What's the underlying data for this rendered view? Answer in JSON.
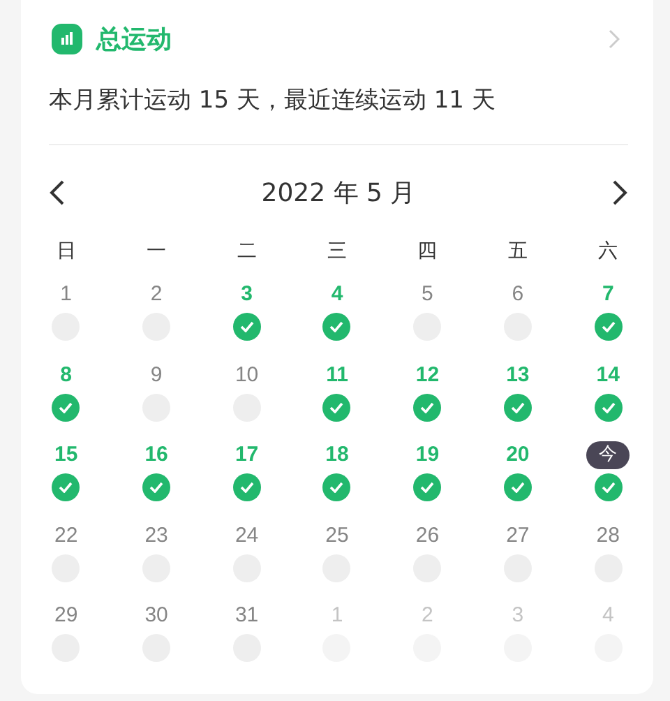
{
  "header": {
    "title": "总运动"
  },
  "summary": "本月累计运动 15 天，最近连续运动 11 天",
  "calendar": {
    "month": "2022 年 5 月",
    "weekdays": [
      "日",
      "一",
      "二",
      "三",
      "四",
      "五",
      "六"
    ],
    "weeks": [
      {
        "days": [
          {
            "label": "1",
            "checked": false,
            "in_month": true,
            "today": false
          },
          {
            "label": "2",
            "checked": false,
            "in_month": true,
            "today": false
          },
          {
            "label": "3",
            "checked": true,
            "in_month": true,
            "today": false
          },
          {
            "label": "4",
            "checked": true,
            "in_month": true,
            "today": false
          },
          {
            "label": "5",
            "checked": false,
            "in_month": true,
            "today": false
          },
          {
            "label": "6",
            "checked": false,
            "in_month": true,
            "today": false
          },
          {
            "label": "7",
            "checked": true,
            "in_month": true,
            "today": false
          }
        ]
      },
      {
        "days": [
          {
            "label": "8",
            "checked": true,
            "in_month": true,
            "today": false
          },
          {
            "label": "9",
            "checked": false,
            "in_month": true,
            "today": false
          },
          {
            "label": "10",
            "checked": false,
            "in_month": true,
            "today": false
          },
          {
            "label": "11",
            "checked": true,
            "in_month": true,
            "today": false
          },
          {
            "label": "12",
            "checked": true,
            "in_month": true,
            "today": false
          },
          {
            "label": "13",
            "checked": true,
            "in_month": true,
            "today": false
          },
          {
            "label": "14",
            "checked": true,
            "in_month": true,
            "today": false
          }
        ]
      },
      {
        "days": [
          {
            "label": "15",
            "checked": true,
            "in_month": true,
            "today": false
          },
          {
            "label": "16",
            "checked": true,
            "in_month": true,
            "today": false
          },
          {
            "label": "17",
            "checked": true,
            "in_month": true,
            "today": false
          },
          {
            "label": "18",
            "checked": true,
            "in_month": true,
            "today": false
          },
          {
            "label": "19",
            "checked": true,
            "in_month": true,
            "today": false
          },
          {
            "label": "20",
            "checked": true,
            "in_month": true,
            "today": false
          },
          {
            "label": "今",
            "checked": true,
            "in_month": true,
            "today": true
          }
        ]
      },
      {
        "days": [
          {
            "label": "22",
            "checked": false,
            "in_month": true,
            "today": false
          },
          {
            "label": "23",
            "checked": false,
            "in_month": true,
            "today": false
          },
          {
            "label": "24",
            "checked": false,
            "in_month": true,
            "today": false
          },
          {
            "label": "25",
            "checked": false,
            "in_month": true,
            "today": false
          },
          {
            "label": "26",
            "checked": false,
            "in_month": true,
            "today": false
          },
          {
            "label": "27",
            "checked": false,
            "in_month": true,
            "today": false
          },
          {
            "label": "28",
            "checked": false,
            "in_month": true,
            "today": false
          }
        ]
      },
      {
        "days": [
          {
            "label": "29",
            "checked": false,
            "in_month": true,
            "today": false
          },
          {
            "label": "30",
            "checked": false,
            "in_month": true,
            "today": false
          },
          {
            "label": "31",
            "checked": false,
            "in_month": true,
            "today": false
          },
          {
            "label": "1",
            "checked": false,
            "in_month": false,
            "today": false
          },
          {
            "label": "2",
            "checked": false,
            "in_month": false,
            "today": false
          },
          {
            "label": "3",
            "checked": false,
            "in_month": false,
            "today": false
          },
          {
            "label": "4",
            "checked": false,
            "in_month": false,
            "today": false
          }
        ]
      }
    ]
  }
}
